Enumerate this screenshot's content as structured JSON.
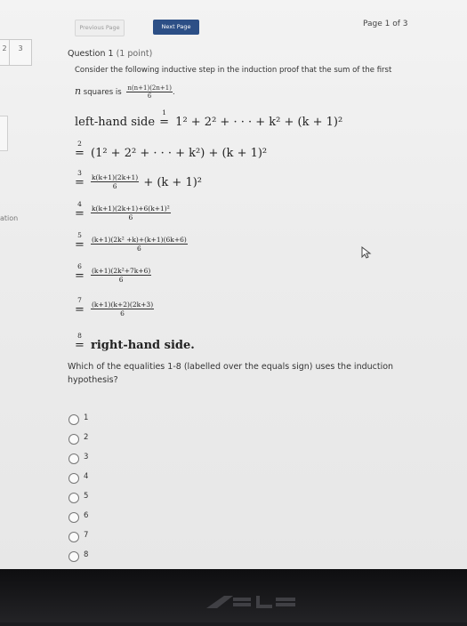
{
  "nav": {
    "prev_label": "Previous Page",
    "next_label": "Next Page",
    "page_indicator": "Page 1 of 3"
  },
  "sidebar": {
    "thumb1": "2",
    "thumb2": "3",
    "cut_text": "ation"
  },
  "question": {
    "title": "Question 1",
    "points": "(1 point)",
    "intro_line1": "Consider the following inductive step in the induction proof that the sum of the first",
    "intro_var": "n",
    "intro_line2": "squares is",
    "formula_num": "n(n+1)(2n+1)",
    "formula_den": "6",
    "prompt": "Which of the equalities 1-8 (labelled over the equals sign) uses the induction hypothesis?"
  },
  "proof": {
    "lhs_label": "left-hand side",
    "line1_expr": "1² + 2² + · · · + k² + (k + 1)²",
    "line2_expr": "(1² + 2² + · · · + k²) + (k + 1)²",
    "line3_num": "k(k+1)(2k+1)",
    "line3_den": "6",
    "line3_tail": "+ (k + 1)²",
    "line4_num": "k(k+1)(2k+1)+6(k+1)²",
    "line4_den": "6",
    "line5_num": "(k+1)(2k² +k)+(k+1)(6k+6)",
    "line5_den": "6",
    "line6_num": "(k+1)(2k²+7k+6)",
    "line6_den": "6",
    "line7_num": "(k+1)(k+2)(2k+3)",
    "line7_den": "6",
    "line8_text": "right-hand side.",
    "labels": [
      "1",
      "2",
      "3",
      "4",
      "5",
      "6",
      "7",
      "8"
    ]
  },
  "options": [
    "1",
    "2",
    "3",
    "4",
    "5",
    "6",
    "7",
    "8"
  ]
}
